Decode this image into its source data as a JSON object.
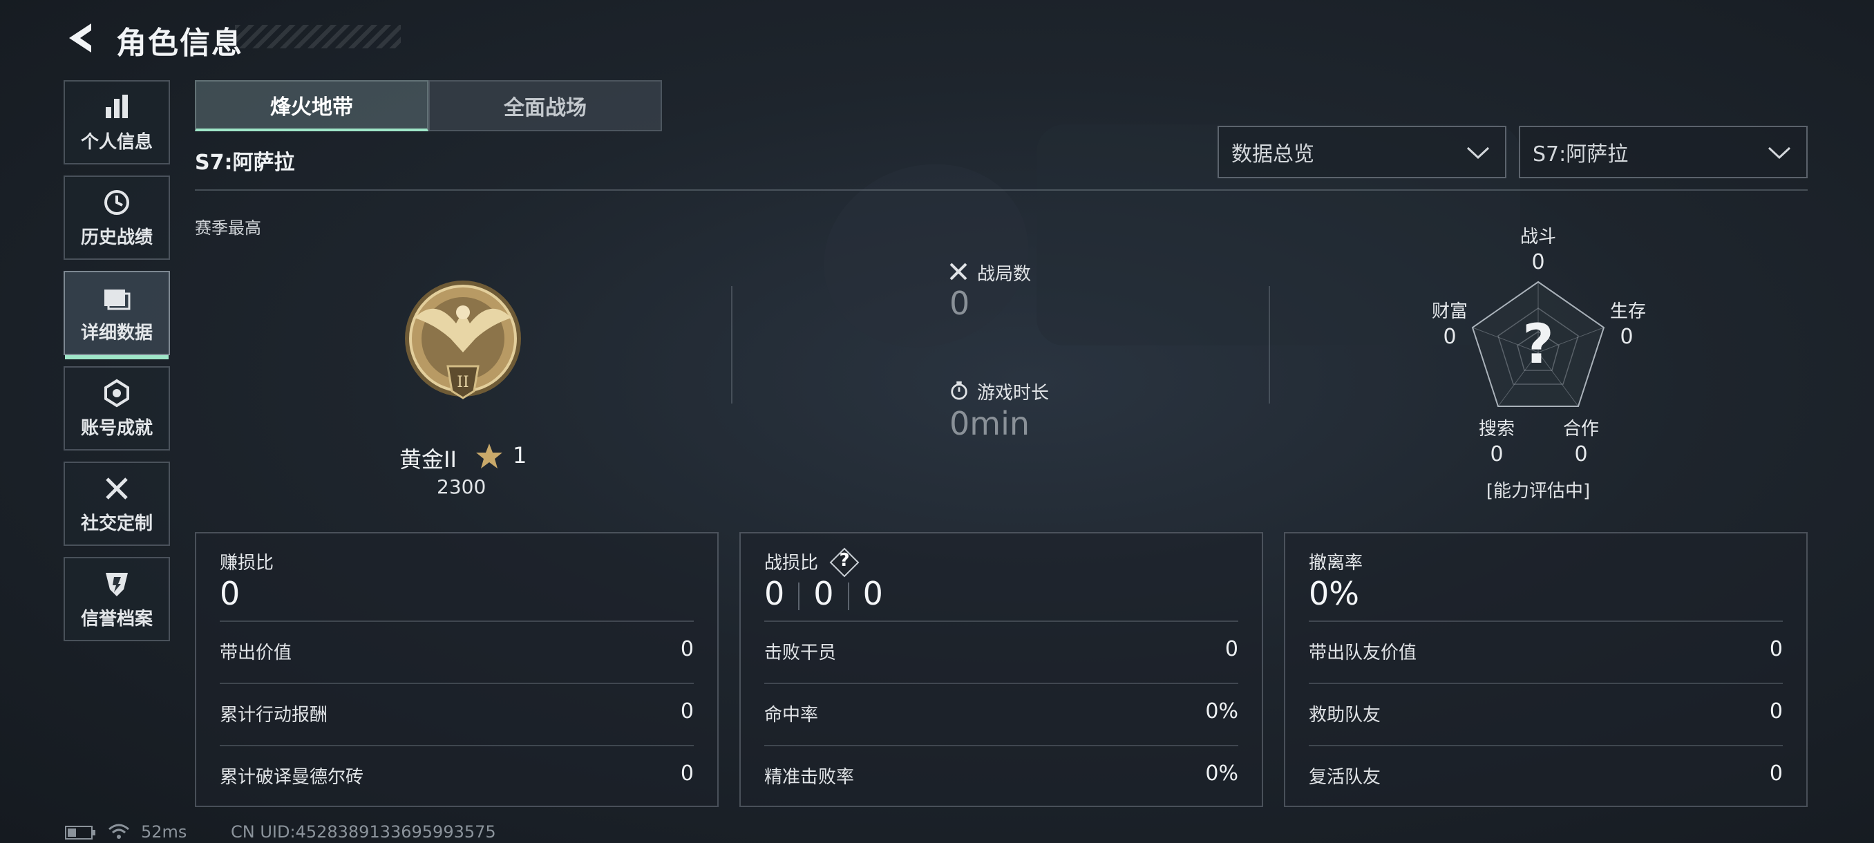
{
  "header": {
    "title": "角色信息"
  },
  "sidebar": {
    "items": [
      {
        "label": "个人信息",
        "icon": "bar-chart-icon"
      },
      {
        "label": "历史战绩",
        "icon": "history-icon"
      },
      {
        "label": "详细数据",
        "icon": "folder-icon",
        "active": true
      },
      {
        "label": "账号成就",
        "icon": "medal-icon"
      },
      {
        "label": "社交定制",
        "icon": "tools-icon"
      },
      {
        "label": "信誉档案",
        "icon": "shield-icon"
      }
    ]
  },
  "tabs": [
    {
      "label": "烽火地带",
      "active": true
    },
    {
      "label": "全面战场",
      "active": false
    }
  ],
  "season": {
    "label": "S7:阿萨拉"
  },
  "filters": {
    "view": "数据总览",
    "season": "S7:阿萨拉"
  },
  "season_best": {
    "label": "赛季最高",
    "rank_name": "黄金II",
    "stars": "1",
    "score": "2300"
  },
  "summary": {
    "matches_label": "战局数",
    "matches_value": "0",
    "playtime_label": "游戏时长",
    "playtime_value": "0min"
  },
  "radar": {
    "center": "?",
    "status": "[能力评估中]",
    "axes": [
      {
        "label": "战斗",
        "value": "0"
      },
      {
        "label": "生存",
        "value": "0"
      },
      {
        "label": "合作",
        "value": "0"
      },
      {
        "label": "搜索",
        "value": "0"
      },
      {
        "label": "财富",
        "value": "0"
      }
    ]
  },
  "cards": [
    {
      "title": "赚损比",
      "value": "0",
      "rows": [
        {
          "label": "带出价值",
          "value": "0"
        },
        {
          "label": "累计行动报酬",
          "value": "0"
        },
        {
          "label": "累计破译曼德尔砖",
          "value": "0"
        }
      ]
    },
    {
      "title": "战损比",
      "help": "?",
      "values": [
        "0",
        "0",
        "0"
      ],
      "rows": [
        {
          "label": "击败干员",
          "value": "0"
        },
        {
          "label": "命中率",
          "value": "0%"
        },
        {
          "label": "精准击败率",
          "value": "0%"
        }
      ]
    },
    {
      "title": "撤离率",
      "value": "0%",
      "rows": [
        {
          "label": "带出队友价值",
          "value": "0"
        },
        {
          "label": "救助队友",
          "value": "0"
        },
        {
          "label": "复活队友",
          "value": "0"
        }
      ]
    }
  ],
  "footer": {
    "ping": "52ms",
    "uid": "CN UID:4528389133695993575"
  },
  "colors": {
    "accent": "#9fe6c8",
    "gold": "#c9a96a"
  }
}
